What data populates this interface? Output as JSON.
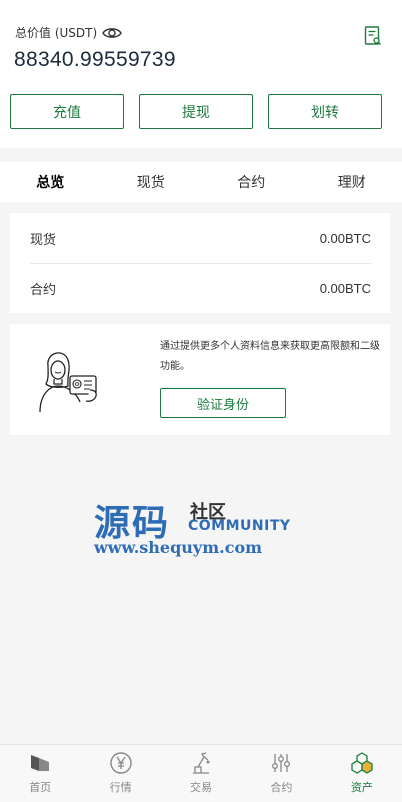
{
  "header": {
    "total_label": "总价值 (USDT)",
    "total_value": "88340.99559739"
  },
  "actions": {
    "deposit": "充值",
    "withdraw": "提现",
    "transfer": "划转"
  },
  "tabs": [
    {
      "label": "总览",
      "active": true
    },
    {
      "label": "现货",
      "active": false
    },
    {
      "label": "合约",
      "active": false
    },
    {
      "label": "理财",
      "active": false
    }
  ],
  "balances": [
    {
      "name": "现货",
      "value": "0.00BTC"
    },
    {
      "name": "合约",
      "value": "0.00BTC"
    }
  ],
  "kyc": {
    "text": "通过提供更多个人资料信息来获取更高限额和二级功能。",
    "button": "验证身份"
  },
  "watermark": {
    "big": "源码",
    "small": "社区",
    "community": "COMMUNITY",
    "url": "www.shequym.com"
  },
  "bottom_nav": [
    {
      "label": "首页",
      "icon": "home-icon"
    },
    {
      "label": "行情",
      "icon": "yen-icon"
    },
    {
      "label": "交易",
      "icon": "trade-icon"
    },
    {
      "label": "合约",
      "icon": "contract-icon"
    },
    {
      "label": "资产",
      "icon": "assets-icon",
      "active": true
    }
  ],
  "colors": {
    "accent": "#1e7a3c",
    "watermark": "#2e6db5"
  }
}
